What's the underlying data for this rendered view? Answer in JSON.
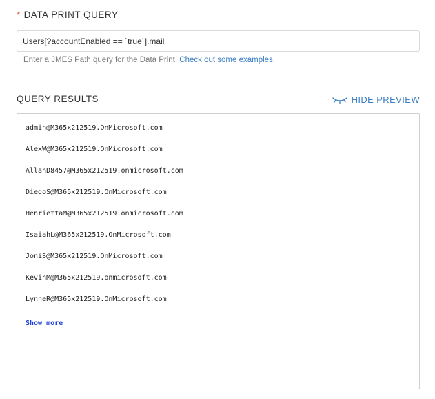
{
  "query_field": {
    "required_marker": "*",
    "label": "DATA PRINT QUERY",
    "value": "Users[?accountEnabled == `true`].mail",
    "help_text": "Enter a JMES Path query for the Data Print.",
    "help_link": "Check out some examples."
  },
  "results": {
    "label": "QUERY RESULTS",
    "hide_preview": "HIDE PREVIEW",
    "hide_preview_icon": "eye-closed-icon",
    "lines": [
      "admin@M365x212519.OnMicrosoft.com",
      "AlexW@M365x212519.OnMicrosoft.com",
      "AllanD8457@M365x212519.onmicrosoft.com",
      "DiegoS@M365x212519.OnMicrosoft.com",
      "HenriettaM@M365x212519.onmicrosoft.com",
      "IsaiahL@M365x212519.OnMicrosoft.com",
      "JoniS@M365x212519.OnMicrosoft.com",
      "KevinM@M365x212519.onmicrosoft.com",
      "LynneR@M365x212519.OnMicrosoft.com"
    ],
    "show_more": "Show more"
  },
  "colors": {
    "accent": "#3b7fc4",
    "required": "#e0533a",
    "show_more": "#1a3dd6"
  }
}
